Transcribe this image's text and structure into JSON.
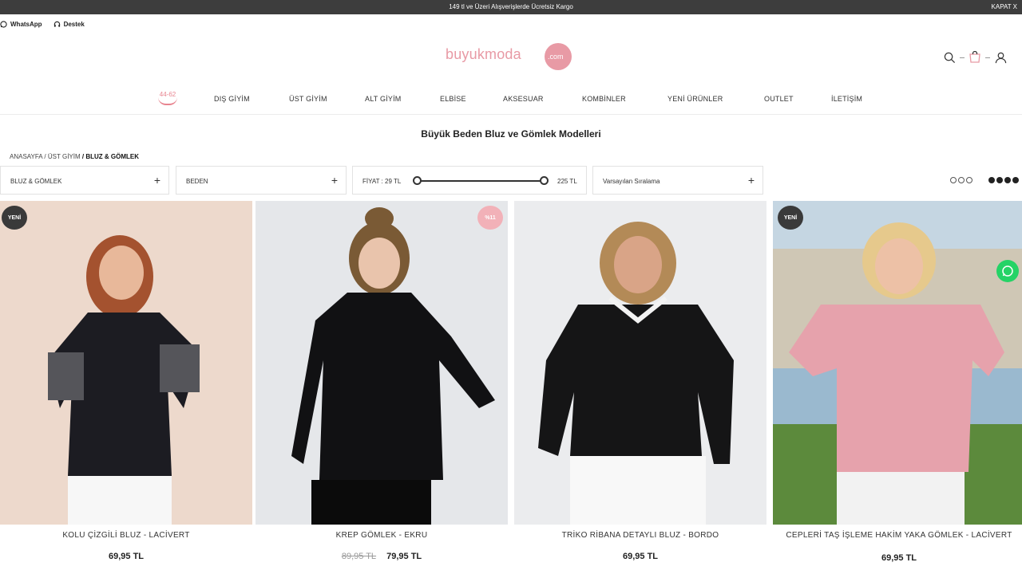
{
  "announcement": {
    "text": "149 tl ve Üzeri Alışverişlerde Ücretsiz Kargo",
    "close": "KAPAT X"
  },
  "contact": {
    "whatsapp": "WhatsApp",
    "support": "Destek"
  },
  "logo": {
    "word": "buyukmoda",
    "com": ".com"
  },
  "header_icons": [
    "search-icon",
    "cart-icon",
    "user-icon"
  ],
  "nav": {
    "size_badge": "44-62",
    "items": [
      "DIŞ GİYİM",
      "ÜST GİYİM",
      "ALT GİYİM",
      "ELBİSE",
      "AKSESUAR",
      "KOMBİNLER",
      "YENİ ÜRÜNLER",
      "OUTLET",
      "İLETİŞİM"
    ]
  },
  "page_title": "Büyük Beden Bluz ve Gömlek Modelleri",
  "breadcrumb": {
    "home": "ANASAYFA /",
    "parent": "ÜST GİYİM",
    "current": "/ BLUZ & GÖMLEK"
  },
  "filters": {
    "category": "BLUZ & GÖMLEK",
    "size": "BEDEN",
    "price_label": "FİYAT : 29 TL",
    "price_max": "225 TL",
    "sort": "Varsayılan Sıralama"
  },
  "products": [
    {
      "name": "KOLU ÇİZGİLİ BLUZ - LACİVERT",
      "old_price": "",
      "price": "69,95 TL",
      "tag": "YENİ"
    },
    {
      "name": "KREP GÖMLEK - EKRU",
      "old_price": "89,95 TL",
      "price": "79,95 TL",
      "tag": "%11"
    },
    {
      "name": "TRİKO RİBANA DETAYLI BLUZ - BORDO",
      "old_price": "",
      "price": "69,95 TL",
      "tag": ""
    },
    {
      "name": "CEPLERİ TAŞ İŞLEME HAKİM YAKA GÖMLEK - LACİVERT",
      "old_price": "",
      "price": "69,95 TL",
      "tag": "YENİ"
    }
  ],
  "colors": {
    "brand_pink": "#e89aa5",
    "topbar": "#3d3d3d",
    "whatsapp": "#25d366"
  }
}
